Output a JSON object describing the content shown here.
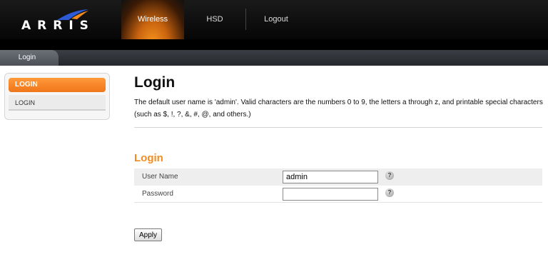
{
  "brand": {
    "logo_text": "ARRIS"
  },
  "nav": {
    "tabs": [
      {
        "label": "Wireless",
        "active": true
      },
      {
        "label": "HSD",
        "active": false
      },
      {
        "label": "Logout",
        "active": false
      }
    ]
  },
  "subnav": {
    "tab": "Login"
  },
  "sidebar": {
    "header": "LOGIN",
    "items": [
      {
        "label": "LOGIN"
      }
    ]
  },
  "main": {
    "title": "Login",
    "description": "The default user name is 'admin'. Valid characters are the numbers 0 to 9, the letters a through z, and printable special characters (such as $, !, ?, &, #, @, and others.)",
    "section_title": "Login",
    "fields": [
      {
        "label": "User Name",
        "value": "admin",
        "help": "?"
      },
      {
        "label": "Password",
        "value": "",
        "help": "?"
      }
    ],
    "apply_label": "Apply"
  },
  "colors": {
    "accent_orange": "#f28c1e",
    "header_bg": "#0a0a0a",
    "subbar_bg": "#2f3237"
  },
  "icons": [
    "arris-swoosh-icon",
    "help-icon"
  ]
}
